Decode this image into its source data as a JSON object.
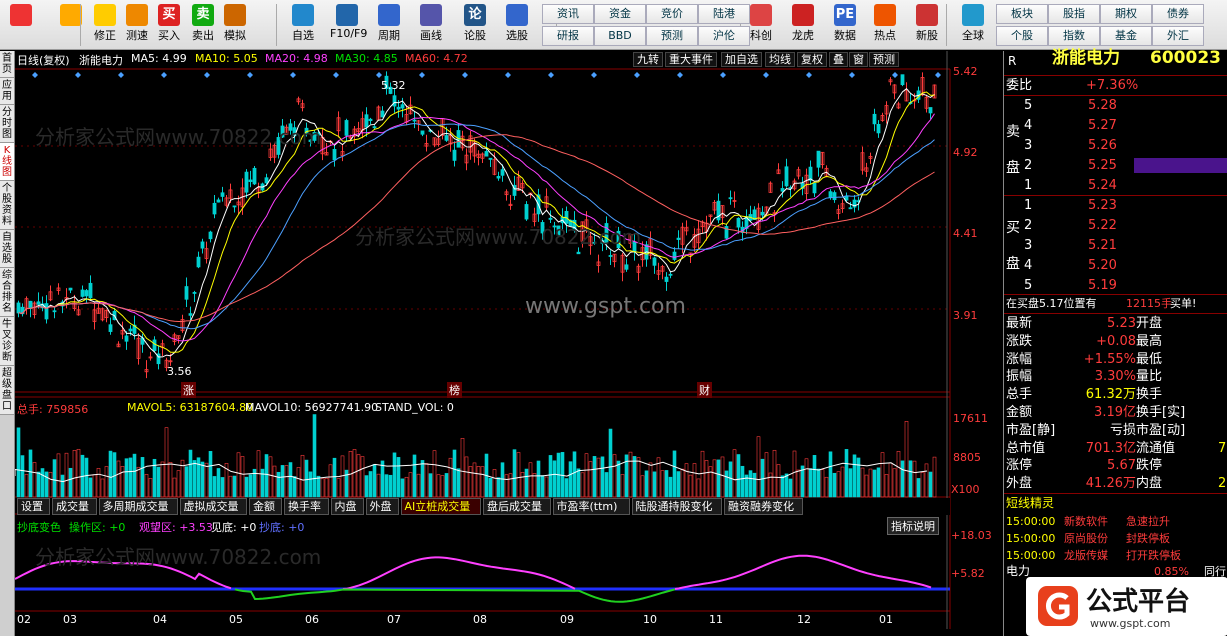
{
  "toolbar": {
    "buttons": [
      {
        "label": "",
        "icon": "grid-icon"
      },
      {
        "label": "",
        "icon": "back-arrow-icon"
      },
      {
        "label": "修正",
        "icon": "up-down-icon"
      },
      {
        "label": "测速",
        "icon": "clock-icon"
      },
      {
        "label": "买入",
        "icon": "buy-icon",
        "glyph": "买"
      },
      {
        "label": "卖出",
        "icon": "sell-icon",
        "glyph": "卖"
      },
      {
        "label": "模拟",
        "icon": "hammer-icon"
      },
      {
        "label": "自选",
        "icon": "star-icon"
      },
      {
        "label": "F10/F9",
        "icon": "doc-icon"
      },
      {
        "label": "周期",
        "icon": "chart-icon"
      },
      {
        "label": "画线",
        "icon": "pen-icon"
      },
      {
        "label": "论股",
        "icon": "discuss-icon",
        "glyph": "论"
      },
      {
        "label": "选股",
        "icon": "select-icon"
      },
      {
        "label": "科创",
        "icon": "kechuang-icon"
      },
      {
        "label": "龙虎",
        "icon": "dragon-icon"
      },
      {
        "label": "数据",
        "icon": "pe-icon",
        "glyph": "PE"
      },
      {
        "label": "热点",
        "icon": "fire-icon"
      },
      {
        "label": "新股",
        "icon": "newstock-icon"
      },
      {
        "label": "全球",
        "icon": "globe-icon"
      }
    ],
    "small_buttons": [
      "资讯",
      "资金",
      "竞价",
      "陆港",
      "研报",
      "BBD",
      "预测",
      "沪伦",
      "板块",
      "股指",
      "期权",
      "债券",
      "个股",
      "指数",
      "基金",
      "外汇"
    ]
  },
  "left_tabs": [
    "首页",
    "应用",
    "分时图",
    "K线图",
    "个股资料",
    "自选股",
    "综合排名",
    "牛叉诊断",
    "超级盘口"
  ],
  "header": {
    "period": "日线(复权)",
    "name": "浙能电力",
    "ma5": "MA5: 4.99",
    "ma10": "MA10: 5.05",
    "ma20": "MA20: 4.98",
    "ma30": "MA30: 4.85",
    "ma60": "MA60: 4.72",
    "right_buttons": [
      "九转",
      "重大事件",
      "加自选",
      "均线",
      "复权",
      "叠",
      "窗",
      "预测"
    ]
  },
  "price_axis": [
    "5.42",
    "4.92",
    "4.41",
    "3.91"
  ],
  "annotations": {
    "high": "5.32",
    "low": "3.56",
    "watermark": "www.gspt.com",
    "watermark2": "分析家公式网www.70822.com"
  },
  "markers": [
    "涨",
    "榜",
    "财"
  ],
  "volume": {
    "label": "总手: 759856",
    "mavol5": "MAVOL5: 63187604.80",
    "mavol10": "MAVOL10: 56927741.90",
    "stand": "STAND_VOL: 0",
    "axis": [
      "17611",
      "8805",
      "X100"
    ]
  },
  "tabs": [
    "设置",
    "成交量",
    "多周期成交量",
    "虚拟成交量",
    "金额",
    "换手率",
    "内盘",
    "外盘",
    "AI立桩成交量",
    "盘后成交量",
    "市盈率(ttm)",
    "陆股通持股变化",
    "融资融券变化"
  ],
  "indicator": {
    "name": "抄底变色",
    "op": "操作区: +0",
    "watch": "观望区: +3.53",
    "see": "见底: +0",
    "bottom": "抄底: +0",
    "help": "指标说明",
    "axis": [
      "+18.03",
      "+5.82"
    ]
  },
  "months": [
    "02",
    "03",
    "04",
    "05",
    "06",
    "07",
    "08",
    "09",
    "10",
    "11",
    "12",
    "01"
  ],
  "quote": {
    "code": "600023",
    "name": "浙能电力",
    "weibi_label": "委比",
    "weibi": "+7.36%",
    "sell_label": [
      "卖",
      "盘"
    ],
    "buy_label": [
      "买",
      "盘"
    ],
    "sells": [
      [
        "5",
        "5.28"
      ],
      [
        "4",
        "5.27"
      ],
      [
        "3",
        "5.26"
      ],
      [
        "2",
        "5.25"
      ],
      [
        "1",
        "5.24"
      ]
    ],
    "buys": [
      [
        "1",
        "5.23"
      ],
      [
        "2",
        "5.22"
      ],
      [
        "3",
        "5.21"
      ],
      [
        "4",
        "5.20"
      ],
      [
        "5",
        "5.19"
      ]
    ],
    "status": "在买盘5.17位置有",
    "status_vol": "12115手",
    "status_tail": "买单!",
    "stats": [
      [
        "最新",
        "5.23",
        "开盘",
        ""
      ],
      [
        "涨跌",
        "+0.08",
        "最高",
        ""
      ],
      [
        "涨幅",
        "+1.55%",
        "最低",
        ""
      ],
      [
        "振幅",
        "3.30%",
        "量比",
        ""
      ],
      [
        "总手",
        "61.32万",
        "换手",
        ""
      ],
      [
        "金额",
        "3.19亿",
        "换手[实]",
        ""
      ],
      [
        "市盈[静]",
        "亏损",
        "市盈[动]",
        ""
      ],
      [
        "总市值",
        "701.3亿",
        "流通值",
        "7"
      ],
      [
        "涨停",
        "5.67",
        "跌停",
        ""
      ],
      [
        "外盘",
        "41.26万",
        "内盘",
        "2"
      ]
    ],
    "sprite_title": "短线精灵",
    "sprite": [
      [
        "15:00:00",
        "新数软件",
        "急速拉升"
      ],
      [
        "15:00:00",
        "原尚股份",
        "封跌停板"
      ],
      [
        "15:00:00",
        "龙版传媒",
        "打开跌停板"
      ]
    ],
    "bottom_label": "电力",
    "bottom_pct": "0.85%",
    "bottom_side": "同行"
  },
  "logo": {
    "text": "公式平台",
    "url": "www.gspt.com"
  },
  "colors": {
    "up": "#ff3c3c",
    "down": "#00d0d0",
    "ma5": "#ffffff",
    "ma10": "#ffff00",
    "ma20": "#ff40ff",
    "ma30": "#00ff00",
    "ma60": "#ff6060"
  }
}
